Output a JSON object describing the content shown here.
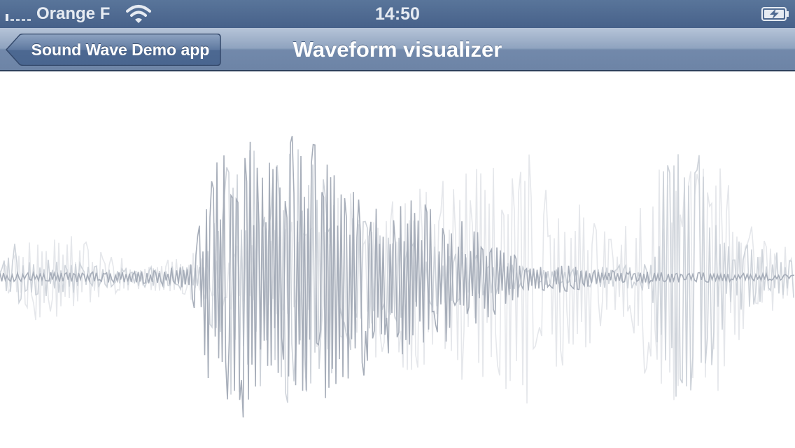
{
  "status_bar": {
    "carrier": "Orange F",
    "time": "14:50",
    "signal_icon": "signal-bars-icon",
    "wifi_icon": "wifi-icon",
    "battery_icon": "battery-charging-icon",
    "background_color": "#4f6a92"
  },
  "nav_bar": {
    "back_label": "Sound Wave Demo app",
    "title": "Waveform visualizer",
    "back_icon": "back-chevron-icon",
    "tint_color": "#6d84a6"
  },
  "waveform": {
    "colors": {
      "primary": "#a6adb9",
      "secondary": "#ced3da",
      "tertiary": "#e5e7eb"
    }
  }
}
